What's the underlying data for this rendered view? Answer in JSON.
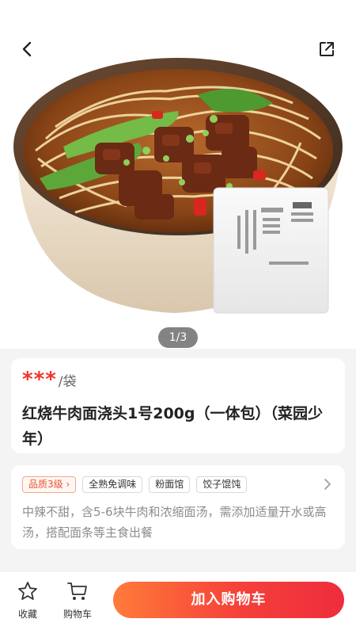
{
  "hero": {
    "pager": "1/3",
    "back_icon": "chevron-left-icon",
    "share_icon": "share-icon",
    "image": "beef-noodle-bowl-photo"
  },
  "product": {
    "price_mask": "***",
    "unit": "/袋",
    "name": "红烧牛肉面浇头1号200g（一体包）（菜园少年）"
  },
  "tags": {
    "quality": "品质3级 ›",
    "items": [
      "全熟免调味",
      "粉面馆",
      "饺子馄饨"
    ],
    "description": "中辣不甜，含5-6块牛肉和浓缩面汤，需添加适量开水或高汤，搭配面条等主食出餐"
  },
  "bottom_bar": {
    "favorite_label": "收藏",
    "cart_label": "购物车",
    "add_to_cart_label": "加入购物车"
  },
  "colors": {
    "price": "#f0352b",
    "button_start": "#ff7b3a",
    "button_end": "#ee2d3c",
    "quality_tag": "#e8552e"
  }
}
